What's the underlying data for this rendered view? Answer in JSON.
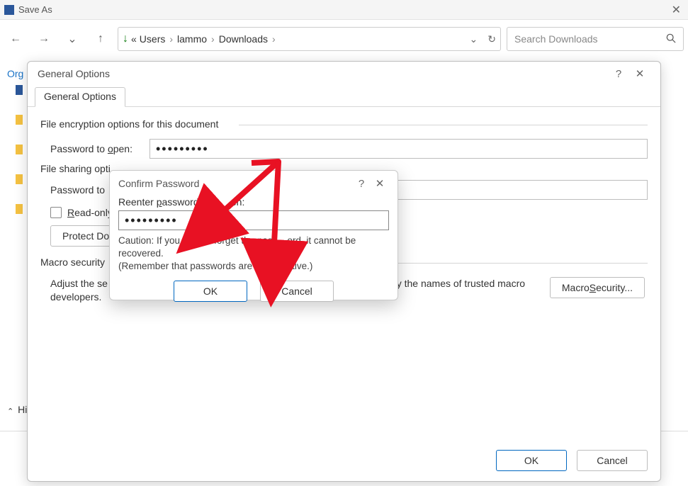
{
  "saveas": {
    "title": "Save As",
    "nav": {
      "back_icon": "←",
      "forward_icon": "→",
      "recent_icon": "⌄",
      "up_icon": "↑"
    },
    "breadcrumb": {
      "download_glyph": "↓",
      "double_chevron": "«",
      "seg1": "Users",
      "seg2": "lammo",
      "seg3": "Downloads",
      "dropdown_glyph": "⌄",
      "refresh_glyph": "↻"
    },
    "search_placeholder": "Search Downloads",
    "organize_hint": "Org",
    "hide_label": "Hi"
  },
  "general_options": {
    "title": "General Options",
    "tab_label": "General Options",
    "section_encrypt": "File encryption options for this document",
    "password_open_label_pre": "Password to ",
    "password_open_hot": "o",
    "password_open_label_post": "pen:",
    "password_open_value": "•••••••••",
    "section_share": "File sharing opti",
    "password_modify_label": "Password to ",
    "readonly_pre": "",
    "readonly_hot": "R",
    "readonly_post": "ead-only",
    "protect_btn": "Protect Do",
    "macro_title": "Macro security",
    "macro_text_left": "Adjust the se",
    "macro_text_right": "y the names of trusted macro developers.",
    "macro_btn_pre": "Macro ",
    "macro_btn_hot": "S",
    "macro_btn_post": "ecurity...",
    "ok": "OK",
    "cancel": "Cancel",
    "help_glyph": "?",
    "close_glyph": "✕"
  },
  "confirm_password": {
    "title": "Confirm Password",
    "help_glyph": "?",
    "close_glyph": "✕",
    "reenter_pre": "Reenter ",
    "reenter_hot": "p",
    "reenter_mid": "assword to o",
    "reenter_end": "en:",
    "value": "•••••••••",
    "caution1": "Caution: If you lose or forget the pass",
    "caution2": "ord, it cannot be recovered.",
    "caution3": "(Remember that passwords are case",
    "caution4": "sitive.)",
    "ok": "OK",
    "cancel": "Cancel"
  }
}
